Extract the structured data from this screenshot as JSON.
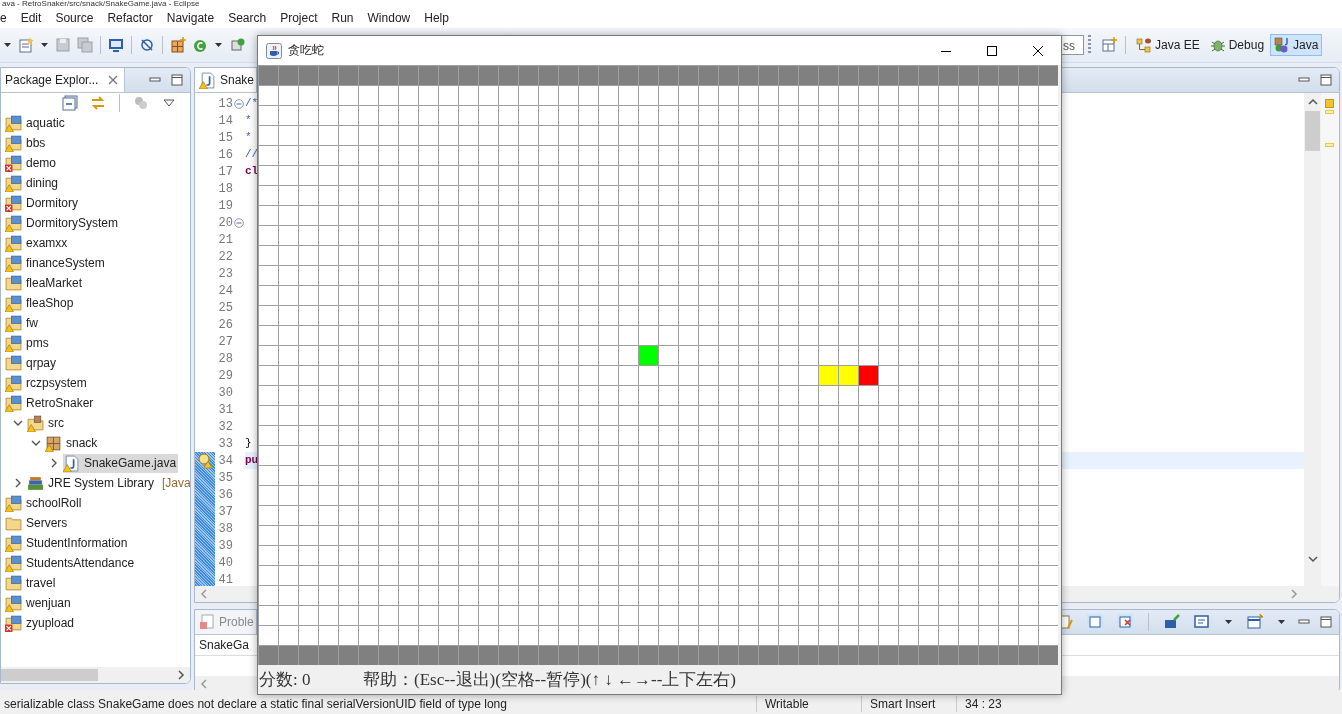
{
  "window": {
    "title": "ava - RetroSnaker/src/snack/SnakeGame.java - Eclipse"
  },
  "menu": [
    "e",
    "Edit",
    "Source",
    "Refactor",
    "Navigate",
    "Search",
    "Project",
    "Run",
    "Window",
    "Help"
  ],
  "toolbar": {
    "quick_access": "ss",
    "perspectives": [
      {
        "label": "Java EE",
        "kind": "javaee",
        "selected": false
      },
      {
        "label": "Debug",
        "kind": "debug",
        "selected": false
      },
      {
        "label": "Java",
        "kind": "java",
        "selected": true
      }
    ]
  },
  "package_explorer": {
    "title": "Package Explor...",
    "tree": [
      {
        "label": "aquatic",
        "kind": "project",
        "warning": true,
        "error": false,
        "selected": false
      },
      {
        "label": "bbs",
        "kind": "project",
        "warning": true,
        "error": false,
        "selected": false
      },
      {
        "label": "demo",
        "kind": "project",
        "warning": false,
        "error": true,
        "selected": false
      },
      {
        "label": "dining",
        "kind": "project",
        "warning": true,
        "error": false,
        "selected": false
      },
      {
        "label": "Dormitory",
        "kind": "project",
        "warning": false,
        "error": true,
        "selected": false
      },
      {
        "label": "DormitorySystem",
        "kind": "project",
        "warning": true,
        "error": false,
        "selected": false
      },
      {
        "label": "examxx",
        "kind": "project",
        "warning": true,
        "error": false,
        "selected": false
      },
      {
        "label": "financeSystem",
        "kind": "project",
        "warning": true,
        "error": false,
        "selected": false
      },
      {
        "label": "fleaMarket",
        "kind": "project",
        "warning": false,
        "error": false,
        "selected": false
      },
      {
        "label": "fleaShop",
        "kind": "project",
        "warning": true,
        "error": false,
        "selected": false
      },
      {
        "label": "fw",
        "kind": "project",
        "warning": true,
        "error": false,
        "selected": false
      },
      {
        "label": "pms",
        "kind": "project",
        "warning": true,
        "error": false,
        "selected": false
      },
      {
        "label": "qrpay",
        "kind": "project",
        "warning": false,
        "error": false,
        "selected": false
      },
      {
        "label": "rczpsystem",
        "kind": "project",
        "warning": true,
        "error": false,
        "selected": false
      },
      {
        "label": "RetroSnaker",
        "kind": "project",
        "warning": true,
        "error": false,
        "selected": false,
        "children": [
          {
            "label": "src",
            "kind": "source-folder",
            "warning": true,
            "error": false,
            "selected": false,
            "expanded": true,
            "children": [
              {
                "label": "snack",
                "kind": "package",
                "warning": true,
                "error": false,
                "selected": false,
                "expanded": true,
                "children": [
                  {
                    "label": "SnakeGame.java",
                    "kind": "file",
                    "warning": true,
                    "error": false,
                    "selected": true,
                    "expanded": false
                  }
                ]
              }
            ]
          },
          {
            "label": "JRE System Library",
            "decoration": "[Java",
            "kind": "library",
            "warning": false,
            "error": false,
            "selected": false,
            "expanded": false
          }
        ]
      },
      {
        "label": "schoolRoll",
        "kind": "project",
        "warning": true,
        "error": false,
        "selected": false
      },
      {
        "label": "Servers",
        "kind": "folder",
        "warning": false,
        "error": false,
        "selected": false
      },
      {
        "label": "StudentInformation",
        "kind": "project",
        "warning": true,
        "error": false,
        "selected": false
      },
      {
        "label": "StudentsAttendance",
        "kind": "project",
        "warning": true,
        "error": false,
        "selected": false
      },
      {
        "label": "travel",
        "kind": "project",
        "warning": false,
        "error": false,
        "selected": false
      },
      {
        "label": "wenjuan",
        "kind": "project",
        "warning": true,
        "error": false,
        "selected": false
      },
      {
        "label": "zyupload",
        "kind": "project",
        "warning": false,
        "error": true,
        "selected": false
      }
    ]
  },
  "editor": {
    "tab": "Snake",
    "lines": [
      {
        "number": "13",
        "fold": true,
        "changed": false,
        "current": false,
        "warning": false,
        "code": "/*",
        "kind": "comment"
      },
      {
        "number": "14",
        "fold": false,
        "changed": false,
        "current": false,
        "warning": false,
        "code": "*",
        "kind": "comment"
      },
      {
        "number": "15",
        "fold": false,
        "changed": false,
        "current": false,
        "warning": false,
        "code": "*",
        "kind": "comment"
      },
      {
        "number": "16",
        "fold": false,
        "changed": false,
        "current": false,
        "warning": false,
        "code": "//",
        "kind": "comment"
      },
      {
        "number": "17",
        "fold": false,
        "changed": false,
        "current": false,
        "warning": false,
        "code": "cl",
        "kind": "keyword"
      },
      {
        "number": "18",
        "fold": false,
        "changed": false,
        "current": false,
        "warning": false
      },
      {
        "number": "19",
        "fold": false,
        "changed": false,
        "current": false,
        "warning": false
      },
      {
        "number": "20",
        "fold": true,
        "changed": false,
        "current": false,
        "warning": false
      },
      {
        "number": "21",
        "fold": false,
        "changed": false,
        "current": false,
        "warning": false
      },
      {
        "number": "22",
        "fold": false,
        "changed": false,
        "current": false,
        "warning": false
      },
      {
        "number": "23",
        "fold": false,
        "changed": false,
        "current": false,
        "warning": false
      },
      {
        "number": "24",
        "fold": false,
        "changed": false,
        "current": false,
        "warning": false
      },
      {
        "number": "25",
        "fold": false,
        "changed": false,
        "current": false,
        "warning": false
      },
      {
        "number": "26",
        "fold": false,
        "changed": false,
        "current": false,
        "warning": false
      },
      {
        "number": "27",
        "fold": false,
        "changed": false,
        "current": false,
        "warning": false
      },
      {
        "number": "28",
        "fold": false,
        "changed": false,
        "current": false,
        "warning": false
      },
      {
        "number": "29",
        "fold": false,
        "changed": false,
        "current": false,
        "warning": false
      },
      {
        "number": "30",
        "fold": false,
        "changed": false,
        "current": false,
        "warning": false
      },
      {
        "number": "31",
        "fold": false,
        "changed": false,
        "current": false,
        "warning": false
      },
      {
        "number": "32",
        "fold": false,
        "changed": false,
        "current": false,
        "warning": false
      },
      {
        "number": "33",
        "fold": false,
        "changed": false,
        "current": false,
        "warning": false,
        "code": "}",
        "kind": "plain"
      },
      {
        "number": "34",
        "fold": false,
        "changed": true,
        "current": true,
        "warning": true,
        "code": "pu",
        "kind": "keyword"
      },
      {
        "number": "35",
        "fold": false,
        "changed": true,
        "current": false,
        "warning": false
      },
      {
        "number": "36",
        "fold": false,
        "changed": true,
        "current": false,
        "warning": false
      },
      {
        "number": "37",
        "fold": false,
        "changed": true,
        "current": false,
        "warning": false
      },
      {
        "number": "38",
        "fold": false,
        "changed": true,
        "current": false,
        "warning": false
      },
      {
        "number": "39",
        "fold": false,
        "changed": true,
        "current": false,
        "warning": false
      },
      {
        "number": "40",
        "fold": false,
        "changed": true,
        "current": false,
        "warning": false
      },
      {
        "number": "41",
        "fold": false,
        "changed": true,
        "current": false,
        "warning": false
      }
    ]
  },
  "problems": {
    "tab": "Proble",
    "row": "SnakeGa"
  },
  "status_bar": {
    "message": "serializable class SnakeGame does not declare a static final serialVersionUID field of type long",
    "mode": "Writable",
    "insert": "Smart Insert",
    "position": "34 : 23"
  },
  "game": {
    "title": "贪吃蛇",
    "cells": [
      {
        "kind": "food"
      },
      {
        "kind": "body"
      },
      {
        "kind": "body"
      },
      {
        "kind": "head"
      }
    ],
    "score": "分数: 0",
    "help": "帮助：(Esc--退出)(空格--暂停)(↑ ↓ ←→--上下左右)"
  }
}
